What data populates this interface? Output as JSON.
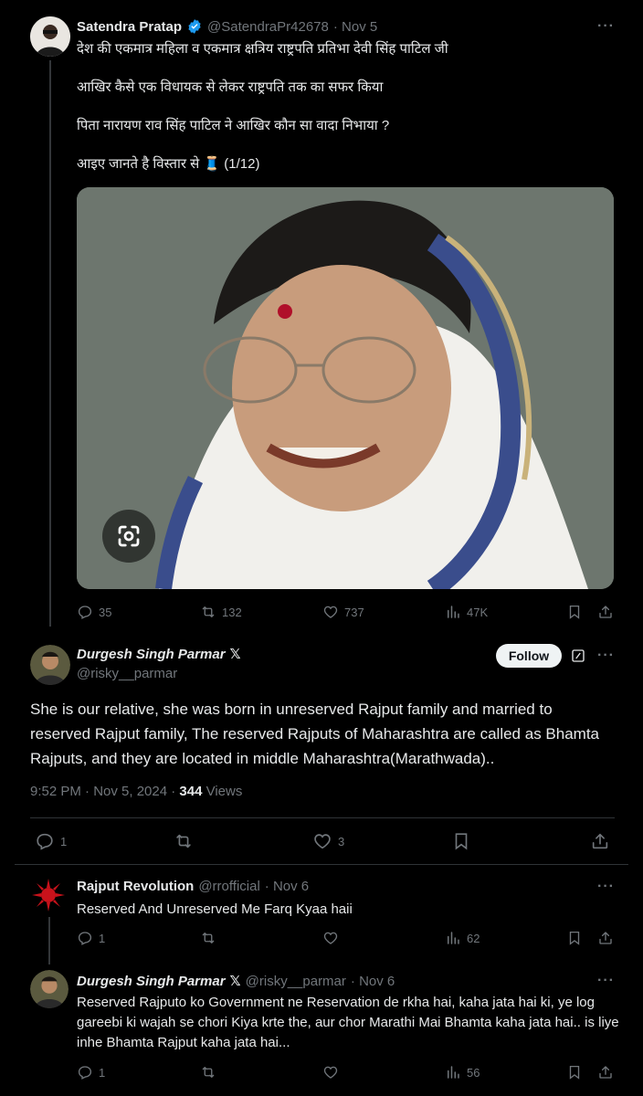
{
  "tweet1": {
    "name": "Satendra Pratap",
    "handle": "@SatendraPr42678",
    "date": "· Nov 5",
    "lines": [
      "देश की  एकमात्र महिला व एकमात्र क्षत्रिय राष्ट्रपति प्रतिभा देवी सिंह पाटिल जी",
      "आखिर कैसे एक विधायक से लेकर राष्ट्रपति तक का सफर किया",
      "पिता नारायण राव सिंह पाटिल ने आखिर कौन सा वादा निभाया ?",
      "आइए जानते है विस्तार से 🧵 (1/12)"
    ],
    "replies": "35",
    "retweets": "132",
    "likes": "737",
    "views": "47K"
  },
  "tweet2": {
    "name": "Durgesh Singh Parmar",
    "handle": "@risky__parmar",
    "follow_label": "Follow",
    "text": "She is our relative, she was born in unreserved Rajput family and married to reserved Rajput family, The reserved Rajputs of Maharashtra are called as Bhamta Rajputs, and they are located in middle Maharashtra(Marathwada)..",
    "timestamp": "9:52 PM · Nov 5, 2024 · ",
    "views_count": "344",
    "views_label": " Views",
    "replies": "1",
    "likes": "3"
  },
  "tweet3": {
    "name": "Rajput Revolution",
    "handle": "@rrofficial",
    "date": "· Nov 6",
    "text": "Reserved And Unreserved Me Farq Kyaa haii",
    "replies": "1",
    "views": "62"
  },
  "tweet4": {
    "name": "Durgesh Singh Parmar",
    "handle": "@risky__parmar",
    "date": "· Nov 6",
    "text": "Reserved Rajputo ko Government ne Reservation de rkha hai, kaha jata hai ki, ye log gareebi ki wajah se chori Kiya krte the, aur chor Marathi Mai Bhamta kaha jata hai.. is liye inhe Bhamta Rajput kaha jata hai...",
    "replies": "1",
    "views": "56"
  },
  "icons": {
    "verified": "verified-badge-icon",
    "x_badge": "x-logo-icon",
    "reply": "reply-icon",
    "retweet": "retweet-icon",
    "like": "heart-icon",
    "views": "views-chart-icon",
    "bookmark": "bookmark-icon",
    "share": "share-icon",
    "lens": "visual-search-icon",
    "grok": "grok-icon"
  },
  "colors": {
    "background": "#000000",
    "text": "#e7e9ea",
    "muted": "#71767b",
    "verified": "#1d9bf0",
    "divider": "#2f3336"
  }
}
